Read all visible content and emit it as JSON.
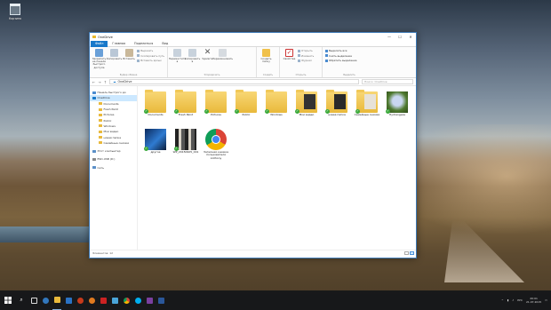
{
  "desktop": {
    "recycle_bin_label": "Корзина"
  },
  "window": {
    "title": "OneDrive",
    "controls": {
      "minimize": "—",
      "maximize": "☐",
      "close": "✕"
    }
  },
  "ribbon_tabs": [
    "Файл",
    "Главная",
    "Поделиться",
    "Вид"
  ],
  "ribbon": {
    "clipboard": {
      "pin_label": "Закрепить на панели быстрого доступа",
      "copy_label": "Копировать",
      "paste_label": "Вставить",
      "cut": "Вырезать",
      "copy_path": "Скопировать путь",
      "paste_shortcut": "Вставить ярлык",
      "group_name": "Буфер обмена"
    },
    "organize": {
      "move_label": "Переместить в",
      "copy_to_label": "Копировать в",
      "delete_label": "Удалить",
      "rename_label": "Переименовать",
      "group_name": "Упорядочить"
    },
    "new": {
      "new_folder_label": "Создать папку",
      "group_name": "Создать"
    },
    "open": {
      "properties_label": "Свойства",
      "open": "Открыть",
      "edit": "Изменить",
      "history": "Журнал",
      "group_name": "Открыть"
    },
    "select": {
      "select_all": "Выделить все",
      "select_none": "Снять выделение",
      "invert": "Обратить выделение",
      "group_name": "Выделить"
    }
  },
  "address": {
    "path": "OneDrive",
    "search_placeholder": "Поиск: OneDrive"
  },
  "nav": {
    "quick_access": "Панель быстрого до",
    "onedrive": "OneDrive",
    "children": [
      "Documents",
      "Fresh Paint",
      "Pictures",
      "Public",
      "Windows",
      "Мои видео",
      "новая папка",
      "Семейные снимки"
    ],
    "this_pc": "Этот компьютер",
    "usb": "ESD-USB (D:)",
    "network": "Сеть"
  },
  "files": [
    {
      "name": "Documents",
      "kind": "folder",
      "synced": true
    },
    {
      "name": "Fresh Paint",
      "kind": "folder",
      "synced": true
    },
    {
      "name": "Pictures",
      "kind": "folder",
      "synced": true
    },
    {
      "name": "Public",
      "kind": "folder",
      "synced": true
    },
    {
      "name": "Windows",
      "kind": "folder",
      "synced": true
    },
    {
      "name": "Мои видео",
      "kind": "folder-dark",
      "synced": true
    },
    {
      "name": "новая папка",
      "kind": "folder-dark",
      "synced": true
    },
    {
      "name": "Семейные снимки",
      "kind": "folder-doc",
      "synced": true
    },
    {
      "name": "Hydrangeas",
      "kind": "photo-green",
      "synced": true
    },
    {
      "name": "другое",
      "kind": "photo-blue",
      "synced": true
    },
    {
      "name": "WP_20150905_001",
      "kind": "photo-film",
      "synced": true
    },
    {
      "name": "Записная книжка пользователя Anthony",
      "kind": "chrome",
      "synced": false
    }
  ],
  "status": {
    "count": "Элементов: 12"
  },
  "taskbar": {
    "clock_time": "20:01",
    "clock_date": "21.07.2015",
    "lang": "РУС"
  },
  "colors": {
    "accent": "#1979ca",
    "selected": "#cce8ff",
    "sync_check": "#3ba93b"
  }
}
